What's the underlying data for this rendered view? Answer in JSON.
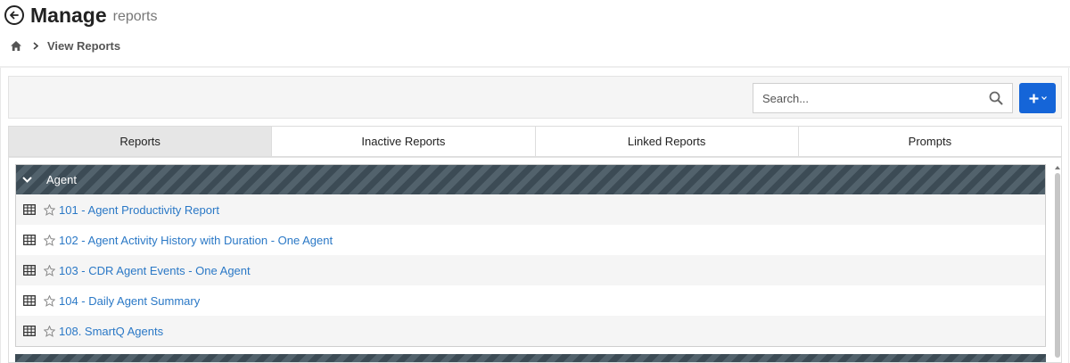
{
  "header": {
    "title": "Manage",
    "subtitle": "reports"
  },
  "breadcrumb": {
    "current": "View Reports"
  },
  "toolbar": {
    "search_placeholder": "Search..."
  },
  "tabs": [
    {
      "label": "Reports",
      "active": true
    },
    {
      "label": "Inactive Reports",
      "active": false
    },
    {
      "label": "Linked Reports",
      "active": false
    },
    {
      "label": "Prompts",
      "active": false
    }
  ],
  "groups": [
    {
      "name": "Agent",
      "expanded": true,
      "reports": [
        {
          "label": "101 - Agent Productivity Report"
        },
        {
          "label": "102 - Agent Activity History with Duration - One Agent"
        },
        {
          "label": "103 - CDR Agent Events - One Agent"
        },
        {
          "label": "104 - Daily Agent Summary"
        },
        {
          "label": "108. SmartQ Agents"
        }
      ]
    }
  ],
  "colors": {
    "accent": "#1565d8",
    "link": "#2a78c6",
    "group_header": "#3c4b55"
  }
}
